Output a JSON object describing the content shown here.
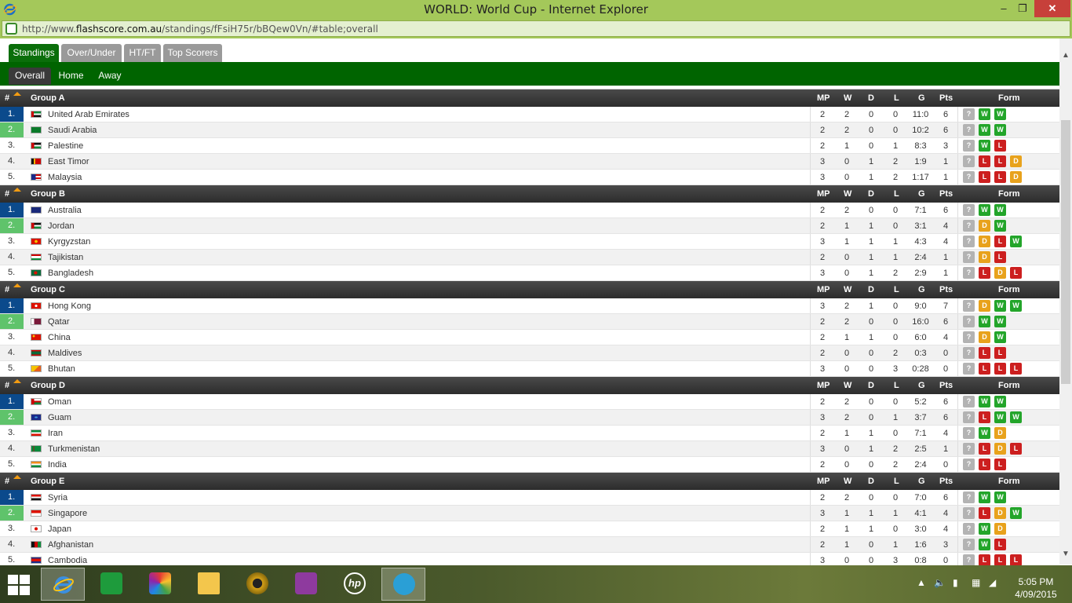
{
  "window": {
    "title": "WORLD: World Cup - Internet Explorer",
    "url_prefix": "http://www.",
    "url_domain": "flashscore.com.au",
    "url_path": "/standings/fFsiH75r/bBQew0Vn/#table;overall",
    "min_label": "–",
    "max_label": "❐",
    "close_label": "✕"
  },
  "tabs": [
    "Standings",
    "Over/Under",
    "HT/FT",
    "Top Scorers"
  ],
  "subtabs": [
    "Overall",
    "Home",
    "Away"
  ],
  "columns": {
    "hash": "#",
    "mp": "MP",
    "w": "W",
    "d": "D",
    "l": "L",
    "g": "G",
    "pts": "Pts",
    "form": "Form"
  },
  "groups": [
    {
      "name": "Group A",
      "rows": [
        {
          "rank": "1.",
          "team": "United Arab Emirates",
          "flag": "uae",
          "mp": "2",
          "w": "2",
          "d": "0",
          "l": "0",
          "g": "11:0",
          "pts": "6",
          "form": [
            "?",
            "W",
            "W"
          ]
        },
        {
          "rank": "2.",
          "team": "Saudi Arabia",
          "flag": "sau",
          "mp": "2",
          "w": "2",
          "d": "0",
          "l": "0",
          "g": "10:2",
          "pts": "6",
          "form": [
            "?",
            "W",
            "W"
          ]
        },
        {
          "rank": "3.",
          "team": "Palestine",
          "flag": "pal",
          "mp": "2",
          "w": "1",
          "d": "0",
          "l": "1",
          "g": "8:3",
          "pts": "3",
          "form": [
            "?",
            "W",
            "L"
          ]
        },
        {
          "rank": "4.",
          "team": "East Timor",
          "flag": "tls",
          "mp": "3",
          "w": "0",
          "d": "1",
          "l": "2",
          "g": "1:9",
          "pts": "1",
          "form": [
            "?",
            "L",
            "L",
            "D"
          ]
        },
        {
          "rank": "5.",
          "team": "Malaysia",
          "flag": "mys",
          "mp": "3",
          "w": "0",
          "d": "1",
          "l": "2",
          "g": "1:17",
          "pts": "1",
          "form": [
            "?",
            "L",
            "L",
            "D"
          ]
        }
      ]
    },
    {
      "name": "Group B",
      "rows": [
        {
          "rank": "1.",
          "team": "Australia",
          "flag": "aus",
          "mp": "2",
          "w": "2",
          "d": "0",
          "l": "0",
          "g": "7:1",
          "pts": "6",
          "form": [
            "?",
            "W",
            "W"
          ]
        },
        {
          "rank": "2.",
          "team": "Jordan",
          "flag": "jor",
          "mp": "2",
          "w": "1",
          "d": "1",
          "l": "0",
          "g": "3:1",
          "pts": "4",
          "form": [
            "?",
            "D",
            "W"
          ]
        },
        {
          "rank": "3.",
          "team": "Kyrgyzstan",
          "flag": "kgz",
          "mp": "3",
          "w": "1",
          "d": "1",
          "l": "1",
          "g": "4:3",
          "pts": "4",
          "form": [
            "?",
            "D",
            "L",
            "W"
          ]
        },
        {
          "rank": "4.",
          "team": "Tajikistan",
          "flag": "tjk",
          "mp": "2",
          "w": "0",
          "d": "1",
          "l": "1",
          "g": "2:4",
          "pts": "1",
          "form": [
            "?",
            "D",
            "L"
          ]
        },
        {
          "rank": "5.",
          "team": "Bangladesh",
          "flag": "bgd",
          "mp": "3",
          "w": "0",
          "d": "1",
          "l": "2",
          "g": "2:9",
          "pts": "1",
          "form": [
            "?",
            "L",
            "D",
            "L"
          ]
        }
      ]
    },
    {
      "name": "Group C",
      "rows": [
        {
          "rank": "1.",
          "team": "Hong Kong",
          "flag": "hkg",
          "mp": "3",
          "w": "2",
          "d": "1",
          "l": "0",
          "g": "9:0",
          "pts": "7",
          "form": [
            "?",
            "D",
            "W",
            "W"
          ]
        },
        {
          "rank": "2.",
          "team": "Qatar",
          "flag": "qat",
          "mp": "2",
          "w": "2",
          "d": "0",
          "l": "0",
          "g": "16:0",
          "pts": "6",
          "form": [
            "?",
            "W",
            "W"
          ]
        },
        {
          "rank": "3.",
          "team": "China",
          "flag": "chn",
          "mp": "2",
          "w": "1",
          "d": "1",
          "l": "0",
          "g": "6:0",
          "pts": "4",
          "form": [
            "?",
            "D",
            "W"
          ]
        },
        {
          "rank": "4.",
          "team": "Maldives",
          "flag": "mdv",
          "mp": "2",
          "w": "0",
          "d": "0",
          "l": "2",
          "g": "0:3",
          "pts": "0",
          "form": [
            "?",
            "L",
            "L"
          ]
        },
        {
          "rank": "5.",
          "team": "Bhutan",
          "flag": "btn",
          "mp": "3",
          "w": "0",
          "d": "0",
          "l": "3",
          "g": "0:28",
          "pts": "0",
          "form": [
            "?",
            "L",
            "L",
            "L"
          ]
        }
      ]
    },
    {
      "name": "Group D",
      "rows": [
        {
          "rank": "1.",
          "team": "Oman",
          "flag": "omn",
          "mp": "2",
          "w": "2",
          "d": "0",
          "l": "0",
          "g": "5:2",
          "pts": "6",
          "form": [
            "?",
            "W",
            "W"
          ]
        },
        {
          "rank": "2.",
          "team": "Guam",
          "flag": "gum",
          "mp": "3",
          "w": "2",
          "d": "0",
          "l": "1",
          "g": "3:7",
          "pts": "6",
          "form": [
            "?",
            "L",
            "W",
            "W"
          ]
        },
        {
          "rank": "3.",
          "team": "Iran",
          "flag": "irn",
          "mp": "2",
          "w": "1",
          "d": "1",
          "l": "0",
          "g": "7:1",
          "pts": "4",
          "form": [
            "?",
            "W",
            "D"
          ]
        },
        {
          "rank": "4.",
          "team": "Turkmenistan",
          "flag": "tkm",
          "mp": "3",
          "w": "0",
          "d": "1",
          "l": "2",
          "g": "2:5",
          "pts": "1",
          "form": [
            "?",
            "L",
            "D",
            "L"
          ]
        },
        {
          "rank": "5.",
          "team": "India",
          "flag": "ind",
          "mp": "2",
          "w": "0",
          "d": "0",
          "l": "2",
          "g": "2:4",
          "pts": "0",
          "form": [
            "?",
            "L",
            "L"
          ]
        }
      ]
    },
    {
      "name": "Group E",
      "rows": [
        {
          "rank": "1.",
          "team": "Syria",
          "flag": "syr",
          "mp": "2",
          "w": "2",
          "d": "0",
          "l": "0",
          "g": "7:0",
          "pts": "6",
          "form": [
            "?",
            "W",
            "W"
          ]
        },
        {
          "rank": "2.",
          "team": "Singapore",
          "flag": "sgp",
          "mp": "3",
          "w": "1",
          "d": "1",
          "l": "1",
          "g": "4:1",
          "pts": "4",
          "form": [
            "?",
            "L",
            "D",
            "W"
          ]
        },
        {
          "rank": "3.",
          "team": "Japan",
          "flag": "jpn",
          "mp": "2",
          "w": "1",
          "d": "1",
          "l": "0",
          "g": "3:0",
          "pts": "4",
          "form": [
            "?",
            "W",
            "D"
          ]
        },
        {
          "rank": "4.",
          "team": "Afghanistan",
          "flag": "afg",
          "mp": "2",
          "w": "1",
          "d": "0",
          "l": "1",
          "g": "1:6",
          "pts": "3",
          "form": [
            "?",
            "W",
            "L"
          ]
        },
        {
          "rank": "5.",
          "team": "Cambodia",
          "flag": "khm",
          "mp": "3",
          "w": "0",
          "d": "0",
          "l": "3",
          "g": "0:8",
          "pts": "0",
          "form": [
            "?",
            "L",
            "L",
            "L"
          ]
        }
      ]
    }
  ],
  "taskbar": {
    "time": "5:05 PM",
    "date": "4/09/2015",
    "apps": [
      "internet-explorer",
      "store",
      "pinwheel-app",
      "file-explorer",
      "media-player",
      "projector-app",
      "hp",
      "lync"
    ]
  },
  "colors": {
    "accent_green": "#006400",
    "rank1": "#0b4a8c",
    "rank2": "#5fc36b",
    "form_win": "#23a52a",
    "form_loss": "#cc1f1f",
    "form_draw": "#e8a21c",
    "form_unknown": "#b3b3b3"
  }
}
